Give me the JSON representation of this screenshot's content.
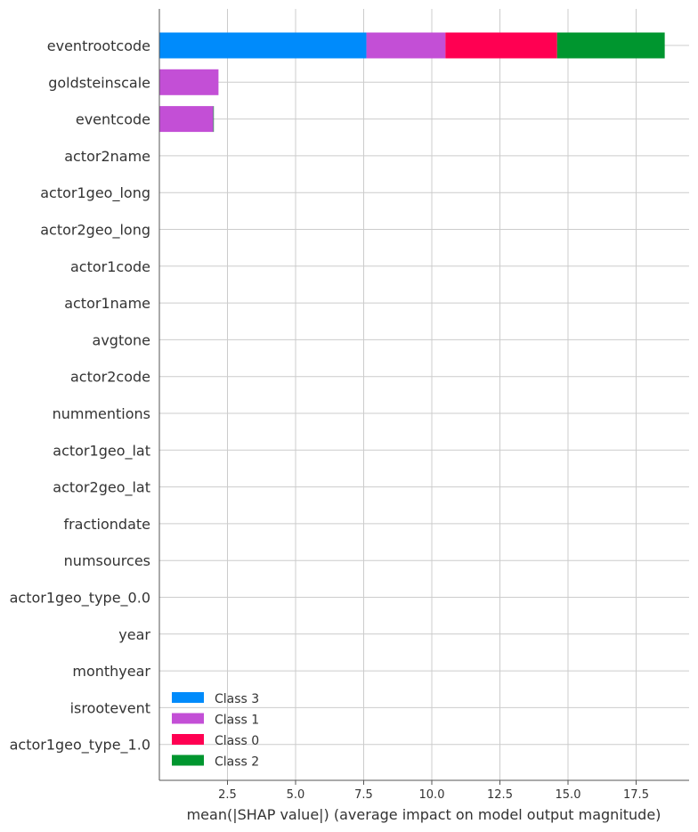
{
  "chart_data": {
    "type": "bar",
    "orientation": "horizontal",
    "stacked": true,
    "xlabel": "mean(|SHAP value|) (average impact on model output magnitude)",
    "ylabel": "",
    "xlim": [
      0,
      19
    ],
    "xticks": [
      2.5,
      5.0,
      7.5,
      10.0,
      12.5,
      15.0,
      17.5
    ],
    "xtick_labels": [
      "2.5",
      "5.0",
      "7.5",
      "10.0",
      "12.5",
      "15.0",
      "17.5"
    ],
    "grid": true,
    "legend_position": "bottom-left",
    "categories": [
      "eventrootcode",
      "goldsteinscale",
      "eventcode",
      "actor2name",
      "actor1geo_long",
      "actor2geo_long",
      "actor1code",
      "actor1name",
      "avgtone",
      "actor2code",
      "nummentions",
      "actor1geo_lat",
      "actor2geo_lat",
      "fractiondate",
      "numsources",
      "actor1geo_type_0.0",
      "year",
      "monthyear",
      "isrootevent",
      "actor1geo_type_1.0"
    ],
    "series": [
      {
        "name": "Class 3",
        "color": "#008bfb",
        "values": [
          7.6,
          0,
          0.01,
          0,
          0,
          0,
          0,
          0,
          0,
          0,
          0,
          0,
          0,
          0,
          0,
          0,
          0,
          0,
          0,
          0
        ]
      },
      {
        "name": "Class 1",
        "color": "#c34fd6",
        "values": [
          2.9,
          2.17,
          1.97,
          0,
          0,
          0,
          0,
          0,
          0,
          0,
          0,
          0,
          0,
          0,
          0,
          0,
          0,
          0,
          0,
          0
        ]
      },
      {
        "name": "Class 0",
        "color": "#ff0052",
        "values": [
          4.1,
          0,
          0,
          0,
          0,
          0,
          0,
          0,
          0,
          0,
          0,
          0,
          0,
          0,
          0,
          0,
          0,
          0,
          0,
          0
        ]
      },
      {
        "name": "Class 2",
        "color": "#00962f",
        "values": [
          3.95,
          0,
          0.02,
          0,
          0,
          0,
          0,
          0,
          0,
          0,
          0,
          0,
          0,
          0,
          0,
          0,
          0,
          0,
          0,
          0
        ]
      }
    ]
  }
}
